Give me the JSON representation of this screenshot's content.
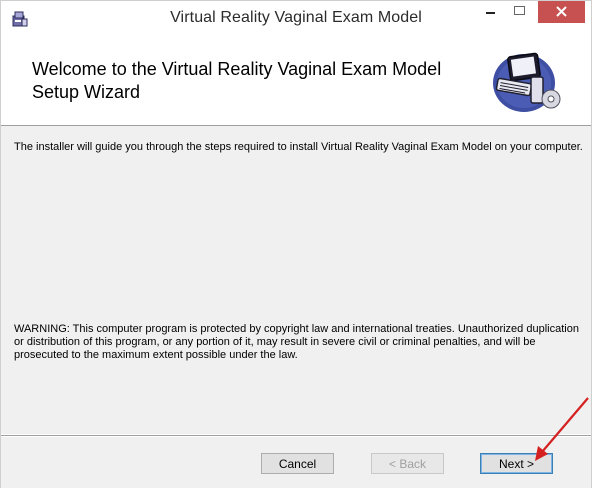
{
  "window": {
    "title": "Virtual Reality Vaginal Exam Model",
    "icon": "installer-icon",
    "controls": [
      "minimize-icon",
      "maximize-icon",
      "close-icon"
    ]
  },
  "header": {
    "title": "Welcome to the Virtual Reality Vaginal Exam Model Setup Wizard",
    "graphic": "computer-setup-icon"
  },
  "body": {
    "intro": "The installer will guide you through the steps required to install Virtual Reality Vaginal Exam Model on your computer.",
    "warning": "WARNING: This computer program is protected by copyright law and international treaties. Unauthorized duplication or distribution of this program, or any portion of it, may result in severe civil or criminal penalties, and will be prosecuted to the maximum extent possible under the law."
  },
  "buttons": {
    "cancel": "Cancel",
    "back": "< Back",
    "next": "Next >"
  },
  "colors": {
    "close_button": "#c75050",
    "annotation_arrow": "#d42020",
    "body_background": "#f0f0f0"
  },
  "annotation": "red-arrow-pointing-to-next"
}
